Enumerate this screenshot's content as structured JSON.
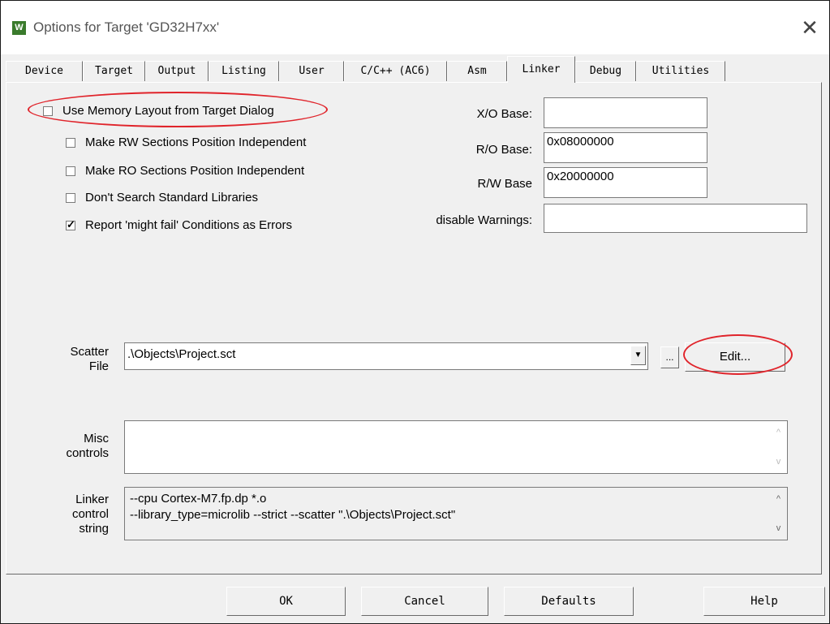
{
  "window": {
    "title": "Options for Target 'GD32H7xx'",
    "icon": "keil-icon",
    "close": "✕"
  },
  "tabs": [
    {
      "label": "Device",
      "active": false
    },
    {
      "label": "Target",
      "active": false
    },
    {
      "label": "Output",
      "active": false
    },
    {
      "label": "Listing",
      "active": false
    },
    {
      "label": "User",
      "active": false
    },
    {
      "label": "C/C++ (AC6)",
      "active": false
    },
    {
      "label": "Asm",
      "active": false
    },
    {
      "label": "Linker",
      "active": true
    },
    {
      "label": "Debug",
      "active": false
    },
    {
      "label": "Utilities",
      "active": false
    }
  ],
  "options": {
    "use_memory_layout": {
      "label": "Use Memory Layout from Target Dialog",
      "checked": false
    },
    "rw_independent": {
      "label": "Make RW Sections Position Independent",
      "checked": false
    },
    "ro_independent": {
      "label": "Make RO Sections Position Independent",
      "checked": false
    },
    "no_std_libs": {
      "label": "Don't Search Standard Libraries",
      "checked": false
    },
    "might_fail_errors": {
      "label": "Report 'might fail' Conditions as Errors",
      "checked": true
    }
  },
  "bases": {
    "xo_label": "X/O Base:",
    "xo_value": "",
    "ro_label": "R/O Base:",
    "ro_value": "0x08000000",
    "rw_label": "R/W Base",
    "rw_value": "0x20000000",
    "warnings_label": "disable Warnings:",
    "warnings_value": ""
  },
  "scatter": {
    "label_line1": "Scatter",
    "label_line2": "File",
    "value": ".\\Objects\\Project.sct",
    "dropdown": "▼",
    "browse": "...",
    "edit": "Edit..."
  },
  "misc": {
    "label_line1": "Misc",
    "label_line2": "controls",
    "value": ""
  },
  "linker": {
    "label_line1": "Linker",
    "label_line2": "control",
    "label_line3": "string",
    "line1": "--cpu Cortex-M7.fp.dp *.o",
    "line2": "--library_type=microlib --strict --scatter \".\\Objects\\Project.sct\""
  },
  "buttons": {
    "ok": "OK",
    "cancel": "Cancel",
    "defaults": "Defaults",
    "help": "Help"
  },
  "colors": {
    "annotation": "#e0242b",
    "dialog_bg": "#f0f0f0"
  }
}
